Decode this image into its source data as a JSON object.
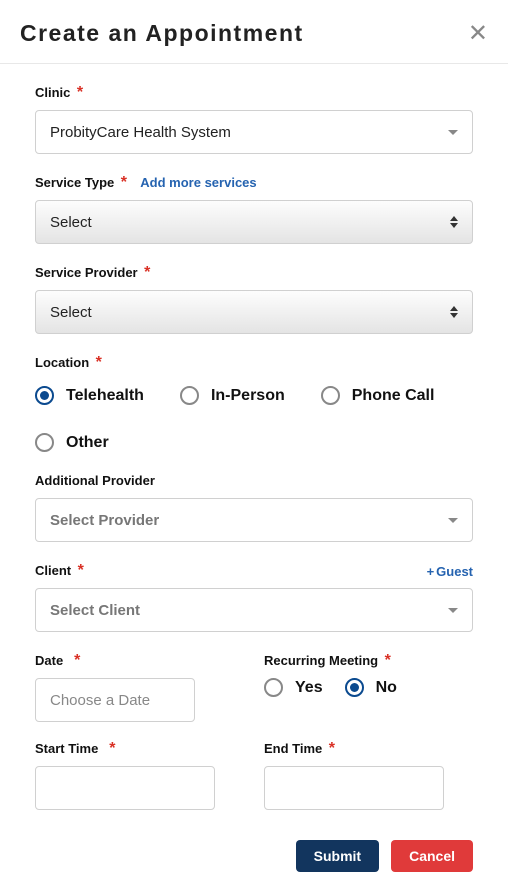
{
  "header": {
    "title": "Create an Appointment"
  },
  "clinic": {
    "label": "Clinic",
    "value": "ProbityCare Health System"
  },
  "serviceType": {
    "label": "Service Type",
    "addLink": "Add more services",
    "placeholder": "Select"
  },
  "serviceProvider": {
    "label": "Service Provider",
    "placeholder": "Select"
  },
  "location": {
    "label": "Location",
    "options": [
      {
        "label": "Telehealth",
        "selected": true
      },
      {
        "label": "In-Person",
        "selected": false
      },
      {
        "label": "Phone Call",
        "selected": false
      },
      {
        "label": "Other",
        "selected": false
      }
    ]
  },
  "additionalProvider": {
    "label": "Additional Provider",
    "placeholder": "Select Provider"
  },
  "client": {
    "label": "Client",
    "guestLink": "Guest",
    "placeholder": "Select Client"
  },
  "date": {
    "label": "Date",
    "placeholder": "Choose a Date"
  },
  "recurring": {
    "label": "Recurring Meeting",
    "options": [
      {
        "label": "Yes",
        "selected": false
      },
      {
        "label": "No",
        "selected": true
      }
    ]
  },
  "startTime": {
    "label": "Start Time"
  },
  "endTime": {
    "label": "End Time"
  },
  "buttons": {
    "submit": "Submit",
    "cancel": "Cancel"
  }
}
